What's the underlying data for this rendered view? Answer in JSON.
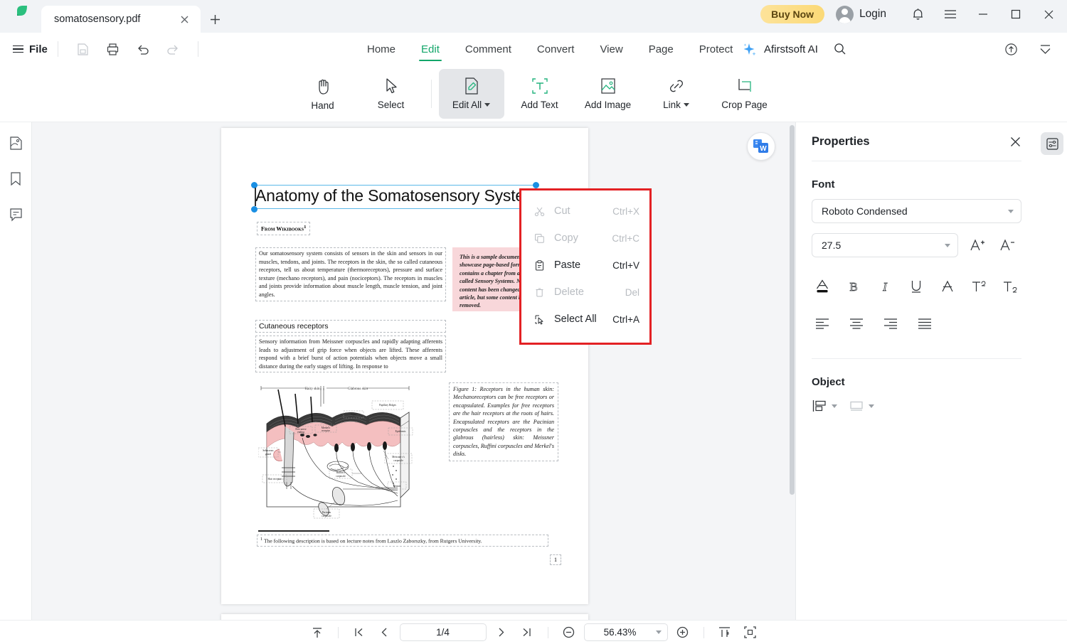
{
  "titlebar": {
    "logo_icon": "afirstsoft-leaf-logo",
    "tab": {
      "title": "somatosensory.pdf",
      "close_icon": "close-icon"
    },
    "new_tab_icon": "plus-icon",
    "buy_now_label": "Buy Now",
    "login_label": "Login",
    "notification_icon": "bell-icon",
    "menu_icon": "hamburger-icon",
    "minimize_icon": "minimize-icon",
    "maximize_icon": "maximize-icon",
    "close_icon": "close-icon"
  },
  "menubar": {
    "file_label": "File",
    "quick_icons": [
      "save-icon",
      "print-icon",
      "undo-icon",
      "redo-icon"
    ],
    "tabs": [
      {
        "label": "Home",
        "active": false
      },
      {
        "label": "Edit",
        "active": true
      },
      {
        "label": "Comment",
        "active": false
      },
      {
        "label": "Convert",
        "active": false
      },
      {
        "label": "View",
        "active": false
      },
      {
        "label": "Page",
        "active": false
      },
      {
        "label": "Protect",
        "active": false
      }
    ],
    "ai_label": "Afirstsoft AI",
    "ai_icon": "sparkle-icon",
    "search_icon": "search-icon",
    "cloud_icon": "cloud-upload-icon",
    "collapse_icon": "collapse-ribbon-icon"
  },
  "ribbon": {
    "tools": [
      {
        "label": "Hand",
        "icon": "hand-icon",
        "selected": false,
        "caret": false
      },
      {
        "label": "Select",
        "icon": "cursor-icon",
        "selected": false,
        "caret": false
      },
      {
        "label": "Edit All",
        "icon": "edit-document-icon",
        "selected": true,
        "caret": true
      },
      {
        "label": "Add Text",
        "icon": "add-text-icon",
        "selected": false,
        "caret": false
      },
      {
        "label": "Add Image",
        "icon": "add-image-icon",
        "selected": false,
        "caret": false
      },
      {
        "label": "Link",
        "icon": "link-icon",
        "selected": false,
        "caret": true
      },
      {
        "label": "Crop Page",
        "icon": "crop-page-icon",
        "selected": false,
        "caret": false
      }
    ]
  },
  "left_rail": {
    "items": [
      {
        "icon": "thumbnail-icon",
        "name": "page-thumbnails"
      },
      {
        "icon": "bookmark-icon",
        "name": "bookmarks"
      },
      {
        "icon": "comment-icon",
        "name": "comments"
      }
    ]
  },
  "document": {
    "title": "Anatomy of the Somatosensory System",
    "source_line": "From Wikibooks",
    "source_note_marker": "1",
    "paragraph_1": "Our somatosensory system consists of sensors in the skin and sensors in our muscles, tendons, and joints. The receptors in the skin, the so called cutaneous receptors, tell us about temperature (thermoreceptors), pressure and surface texture (mechano receptors), and pain (nociceptors). The receptors in muscles and joints provide information about muscle length, muscle tension, and joint angles.",
    "pink_note": "This is a sample document to showcase page-based formatting. It contains a chapter from a Wikibook called Sensory Systems. None of the content has been changed in this article, but some content has been removed.",
    "heading_2": "Cutaneous receptors",
    "paragraph_2": "Sensory information from Meissner corpuscles and rapidly adapting afferents leads to adjustment of grip force when objects are lifted. These afferents respond with a brief burst of action potentials when objects move a small distance during the early stages of lifting. In response to",
    "figure_caption": "Figure 1: Receptors in the human skin: Mechanoreceptors can be free receptors or encapsulated. Examples for free receptors are the hair receptors at the roots of hairs. Encapsulated receptors are the Pacinian corpuscles and the receptors in the glabrous (hairless) skin: Meissner corpuscles, Ruffini corpuscles and Merkel's disks.",
    "figure_labels": [
      "Hairy skin",
      "Glabrous skin",
      "Papillary Ridges",
      "Septa",
      "Free nerve ending",
      "Merkel's receptor",
      "Epidermis",
      "Meissner's corpuscle",
      "Sebaceous gland",
      "Ruffini's corpuscle",
      "Dermis",
      "Hair receptor",
      "Pacinian corpuscle"
    ],
    "footnote": "The following description is based on lecture notes from Laszlo Zaborszky, from Rutgers University.",
    "footnote_marker": "1",
    "page_number": "1",
    "word_badge_icon": "convert-to-word-icon"
  },
  "context_menu": {
    "items": [
      {
        "label": "Cut",
        "shortcut": "Ctrl+X",
        "icon": "scissors-icon",
        "disabled": true
      },
      {
        "label": "Copy",
        "shortcut": "Ctrl+C",
        "icon": "copy-icon",
        "disabled": true
      },
      {
        "label": "Paste",
        "shortcut": "Ctrl+V",
        "icon": "clipboard-icon",
        "disabled": false
      },
      {
        "label": "Delete",
        "shortcut": "Del",
        "icon": "trash-icon",
        "disabled": true
      },
      {
        "label": "Select All",
        "shortcut": "Ctrl+A",
        "icon": "select-all-icon",
        "disabled": false
      }
    ],
    "highlight_color": "#e32124"
  },
  "properties": {
    "title": "Properties",
    "close_icon": "close-icon",
    "font_section_label": "Font",
    "font_family": "Roboto Condensed",
    "font_size": "27.5",
    "increase_font_icon": "increase-font-icon",
    "decrease_font_icon": "decrease-font-icon",
    "format_buttons": [
      {
        "icon": "font-color-icon",
        "name": "font-color"
      },
      {
        "icon": "bold-icon",
        "name": "bold"
      },
      {
        "icon": "italic-icon",
        "name": "italic"
      },
      {
        "icon": "underline-icon",
        "name": "underline"
      },
      {
        "icon": "strikethrough-icon",
        "name": "strikethrough"
      },
      {
        "icon": "superscript-icon",
        "name": "superscript"
      },
      {
        "icon": "subscript-icon",
        "name": "subscript"
      }
    ],
    "align_buttons": [
      {
        "icon": "align-left-icon",
        "name": "align-left"
      },
      {
        "icon": "align-center-icon",
        "name": "align-center"
      },
      {
        "icon": "align-right-icon",
        "name": "align-right"
      },
      {
        "icon": "align-justify-icon",
        "name": "align-justify"
      }
    ],
    "object_section_label": "Object",
    "object_buttons": [
      {
        "icon": "object-align-icon",
        "name": "object-align",
        "disabled": false
      },
      {
        "icon": "object-arrange-icon",
        "name": "object-arrange",
        "disabled": true
      }
    ],
    "panel_toggle_icon": "properties-panel-icon"
  },
  "statusbar": {
    "scroll_top_icon": "scroll-to-top-icon",
    "first_page_icon": "first-page-icon",
    "prev_page_icon": "previous-page-icon",
    "page_indicator": "1/4",
    "next_page_icon": "next-page-icon",
    "last_page_icon": "last-page-icon",
    "zoom_out_icon": "zoom-out-icon",
    "zoom_level": "56.43%",
    "zoom_in_icon": "zoom-in-icon",
    "fit_width_icon": "fit-width-icon",
    "fit_page_icon": "fit-page-icon"
  },
  "colors": {
    "accent_green": "#13a66a",
    "highlight_red": "#e32124",
    "buy_now_yellow": "#fbd977",
    "selection_blue": "#1a8fe3",
    "pink_note": "#f8d7da"
  }
}
